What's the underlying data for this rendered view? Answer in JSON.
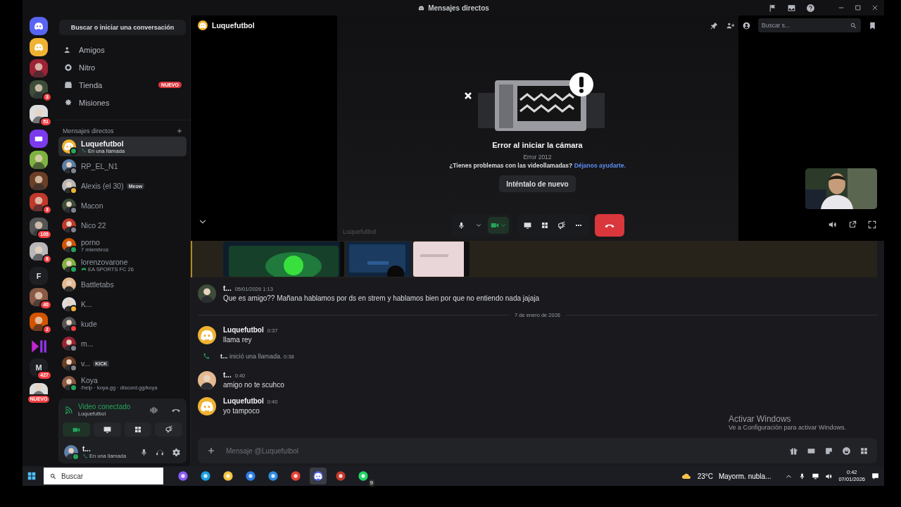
{
  "window": {
    "title": "Mensajes directos"
  },
  "servers": [
    {
      "kind": "home"
    },
    {
      "kind": "dm-call"
    },
    {
      "kind": "server"
    },
    {
      "kind": "server",
      "badge": "3"
    },
    {
      "kind": "server",
      "badge": "51"
    },
    {
      "kind": "purple"
    },
    {
      "kind": "server"
    },
    {
      "kind": "server"
    },
    {
      "kind": "server",
      "badge": "3"
    },
    {
      "kind": "server",
      "badge": "105"
    },
    {
      "kind": "server",
      "badge": "8"
    },
    {
      "kind": "letter",
      "letter": "F"
    },
    {
      "kind": "server",
      "badge": "40"
    },
    {
      "kind": "server",
      "badge": "2"
    },
    {
      "kind": "play"
    },
    {
      "kind": "letter",
      "letter": "M",
      "badge": "427"
    },
    {
      "kind": "server",
      "badge": "NUEVO"
    }
  ],
  "sidebar": {
    "search": "Buscar o iniciar una conversación",
    "nav": [
      {
        "kind": "friends",
        "label": "Amigos"
      },
      {
        "kind": "nitro",
        "label": "Nitro"
      },
      {
        "kind": "shop",
        "label": "Tienda",
        "badge": "NUEVO"
      },
      {
        "kind": "quests",
        "label": "Misiones"
      }
    ],
    "dm_header": "Mensajes directos",
    "dms": [
      {
        "name": "Luquefutbol",
        "subtitle": {
          "kind": "call",
          "text": "En una llamada"
        },
        "avatar": {
          "kind": "logo"
        },
        "color": "#23a55a",
        "selected": true
      },
      {
        "name": "RP_EL_N1",
        "avatar": {
          "kind": "figure"
        },
        "color": "#80848e",
        "selected": false
      },
      {
        "name": "Alexis (el 30)",
        "tag": "Meow",
        "avatar": {
          "kind": "figure"
        },
        "color": "#f0b232",
        "selected": false
      },
      {
        "name": "Macon",
        "avatar": {
          "kind": "figure"
        },
        "color": "#80848e",
        "selected": false
      },
      {
        "name": "Nico 22",
        "avatar": {
          "kind": "figure"
        },
        "color": "#80848e",
        "selected": false
      },
      {
        "name": "porno",
        "subtitle": {
          "kind": "plain",
          "text": "7 miembros"
        },
        "avatar": {
          "kind": "figure"
        },
        "color": "#23a55a",
        "selected": false
      },
      {
        "name": "lorenzovarone",
        "subtitle": {
          "kind": "game",
          "text": "EA SPORTS FC 26"
        },
        "avatar": {
          "kind": "figure"
        },
        "color": "#23a55a",
        "selected": false
      },
      {
        "name": "Battletabs",
        "avatar": {
          "kind": "figure"
        },
        "selected": false
      },
      {
        "name": "K...",
        "avatar": {
          "kind": "figure"
        },
        "color": "#f0b232",
        "selected": false
      },
      {
        "name": "kude",
        "avatar": {
          "kind": "figure"
        },
        "color": "#f23f43",
        "selected": false
      },
      {
        "name": "m...",
        "avatar": {
          "kind": "figure"
        },
        "color": "#80848e",
        "selected": false
      },
      {
        "name": "v...",
        "tag": "KICK",
        "avatar": {
          "kind": "figure"
        },
        "color": "#80848e",
        "selected": false
      },
      {
        "name": "Koya",
        "subtitle": {
          "kind": "plain",
          "text": "/help · koya.gg · discord.gg/koya"
        },
        "avatar": {
          "kind": "figure"
        },
        "color": "#23a55a",
        "selected": false
      }
    ],
    "voice": {
      "title": "Video conectado",
      "channel": "Luquefutbol",
      "camera_on": true
    },
    "user": {
      "name": "t...",
      "status_text": "En una llamada"
    }
  },
  "header": {
    "name": "Luquefutbol",
    "search_placeholder": "Buscar s..."
  },
  "call": {
    "error_title": "Error al iniciar la cámara",
    "error_code": "Error 2012",
    "help_text": "¿Tienes problemas con las videollamadas?",
    "help_link": "Déjanos ayudarte.",
    "retry": "Inténtalo de nuevo",
    "tile_label": "Luquefutbol",
    "camera_on": true
  },
  "messages": [
    {
      "kind": "message",
      "avatar": {
        "kind": "figure"
      },
      "author": "t...",
      "time": "05/01/2026 1:13",
      "text": "Que es amigo?? Mañana hablamos por ds en strem y hablamos bien por que no entiendo nada jajaja"
    },
    {
      "kind": "divider",
      "text": "7 de enero de 2026"
    },
    {
      "kind": "message",
      "avatar": {
        "kind": "logo"
      },
      "author": "Luquefutbol",
      "time": "0:37",
      "text": "llama rey"
    },
    {
      "kind": "call",
      "author": "t...",
      "text": "inició una llamada.",
      "time": "0:38"
    },
    {
      "kind": "message",
      "avatar": {
        "kind": "figure"
      },
      "author": "t...",
      "time": "0:40",
      "text": "amigo no te scuhco"
    },
    {
      "kind": "message",
      "avatar": {
        "kind": "logo"
      },
      "author": "Luquefutbol",
      "time": "0:40",
      "text": "yo tampoco"
    }
  ],
  "composer": {
    "placeholder": "Mensaje @Luquefutbol"
  },
  "activation": {
    "title": "Activar Windows",
    "text": "Ve a Configuración para activar Windows."
  },
  "taskbar": {
    "search": "Buscar",
    "weather_temp": "23°C",
    "weather_text": "Mayorm. nubla...",
    "time": "0:42",
    "date": "07/01/2026",
    "apps": [
      {
        "kind": "copilot"
      },
      {
        "kind": "edge"
      },
      {
        "kind": "folder"
      },
      {
        "kind": "store"
      },
      {
        "kind": "mail"
      },
      {
        "kind": "chrome"
      },
      {
        "kind": "discord",
        "selected": true
      },
      {
        "kind": "clock",
        "selected": false
      },
      {
        "kind": "whatsapp",
        "badge": "9"
      }
    ]
  }
}
